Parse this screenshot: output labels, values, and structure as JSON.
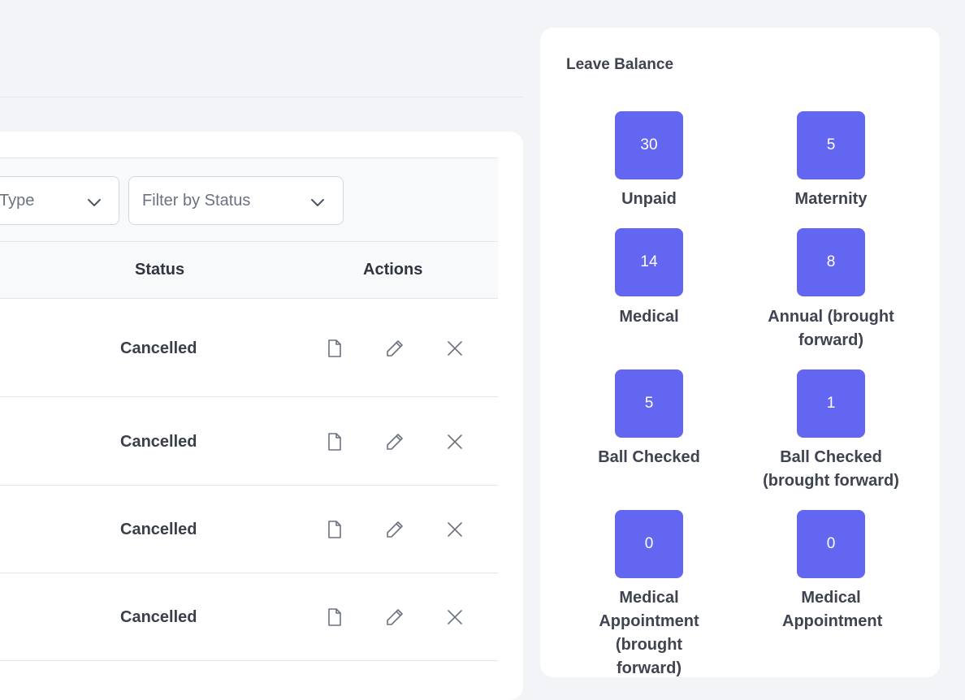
{
  "filters": {
    "type_placeholder": "Type",
    "status_placeholder": "Filter by Status"
  },
  "table": {
    "headers": {
      "status": "Status",
      "actions": "Actions"
    },
    "rows": [
      {
        "status": "Cancelled"
      },
      {
        "status": "Cancelled"
      },
      {
        "status": "Cancelled"
      },
      {
        "status": "Cancelled"
      }
    ],
    "action_icons": [
      "document-icon",
      "pencil-icon",
      "close-icon"
    ]
  },
  "leave_balance": {
    "title": "Leave Balance",
    "tile_color": "#6366f1",
    "items": [
      {
        "value": "30",
        "label": "Unpaid"
      },
      {
        "value": "5",
        "label": "Maternity"
      },
      {
        "value": "14",
        "label": "Medical"
      },
      {
        "value": "8",
        "label": "Annual (brought forward)"
      },
      {
        "value": "5",
        "label": "Ball Checked"
      },
      {
        "value": "1",
        "label": "Ball Checked (brought forward)"
      },
      {
        "value": "0",
        "label": "Medical Appointment (brought forward)"
      },
      {
        "value": "0",
        "label": "Medical Appointment"
      }
    ]
  }
}
